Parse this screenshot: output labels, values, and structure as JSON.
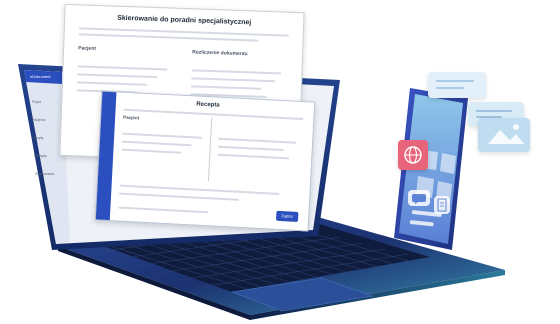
{
  "documents": {
    "back": {
      "title": "Skierowanie do poradni specjalistycznej",
      "left_heading": "Pacjent",
      "right_heading": "Rozliczenie dokumentu"
    },
    "front": {
      "title": "Recepta",
      "left_heading": "Pacjent",
      "button_label": "Zapisz"
    }
  },
  "laptop_sidebar": {
    "title": "eDokument",
    "items": [
      "Pulpit",
      "Pacjenci",
      "Wizyty",
      "Recepty",
      "Skierowania"
    ]
  },
  "phone_icons": [
    "globe-icon",
    "image-icon",
    "chat-icon",
    "document-icon"
  ],
  "colors": {
    "laptop_body": "#1c3b8c",
    "laptop_keyboard": "#1d2f5c",
    "screen_accent": "#2b4fbf",
    "phone_panel": "#c7e0f3",
    "globe_tile": "#e8647a"
  }
}
